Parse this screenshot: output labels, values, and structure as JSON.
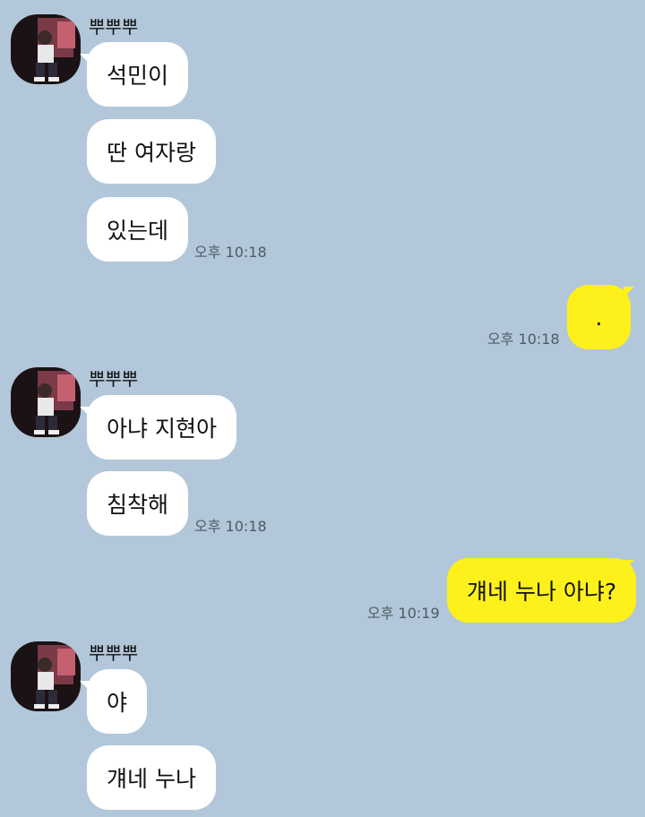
{
  "colors": {
    "background": "#b2c7d9",
    "incoming_bubble": "#ffffff",
    "outgoing_bubble": "#fef01b"
  },
  "groups": [
    {
      "sender": "뿌뿌뿌",
      "avatar_icon": "profile-photo-icon",
      "messages": [
        "석민이",
        "딴 여자랑",
        "있는데"
      ],
      "time": "오후 10:18"
    },
    {
      "outgoing": true,
      "messages": [
        "."
      ],
      "time": "오후 10:18"
    },
    {
      "sender": "뿌뿌뿌",
      "avatar_icon": "profile-photo-icon",
      "messages": [
        "아냐 지현아",
        "침착해"
      ],
      "time": "오후 10:18"
    },
    {
      "outgoing": true,
      "messages": [
        "걔네 누나 아냐?"
      ],
      "time": "오후 10:19"
    },
    {
      "sender": "뿌뿌뿌",
      "avatar_icon": "profile-photo-icon",
      "messages": [
        "야",
        "걔네 누나"
      ]
    }
  ]
}
